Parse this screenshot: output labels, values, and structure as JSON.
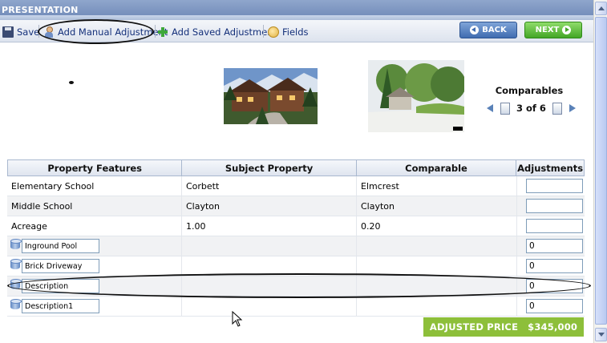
{
  "window": {
    "title": "PRESENTATION"
  },
  "toolbar": {
    "save_label": "Save",
    "add_manual_label": "Add Manual Adjustment",
    "add_saved_label": "Add Saved Adjustment",
    "fields_label": "Fields",
    "back_label": "BACK",
    "next_label": "NEXT"
  },
  "comparables": {
    "title": "Comparables",
    "counter": "3 of 6"
  },
  "table": {
    "headers": [
      "Property Features",
      "Subject Property",
      "Comparable",
      "Adjustments"
    ],
    "rows": [
      {
        "feature": "Elementary School",
        "subject": "Corbett",
        "comparable": "Elmcrest",
        "adjustment": ""
      },
      {
        "feature": "Middle School",
        "subject": "Clayton",
        "comparable": "Clayton",
        "adjustment": ""
      },
      {
        "feature": "Acreage",
        "subject": "1.00",
        "comparable": "0.20",
        "adjustment": ""
      }
    ],
    "custom_rows": [
      {
        "feature_value": "Inground Pool",
        "adjustment": "0"
      },
      {
        "feature_value": "Brick Driveway",
        "adjustment": "0"
      },
      {
        "feature_value": "Description",
        "adjustment": "0"
      },
      {
        "feature_value": "Description1",
        "adjustment": "0"
      }
    ]
  },
  "adjusted_price": {
    "label": "ADJUSTED PRICE",
    "value": "$345,000"
  },
  "colors": {
    "title_bar": "#7a93c0",
    "back_button": "#4f78bb",
    "next_button": "#4fb12f",
    "adjusted_price_bg": "#8dbf3a"
  }
}
